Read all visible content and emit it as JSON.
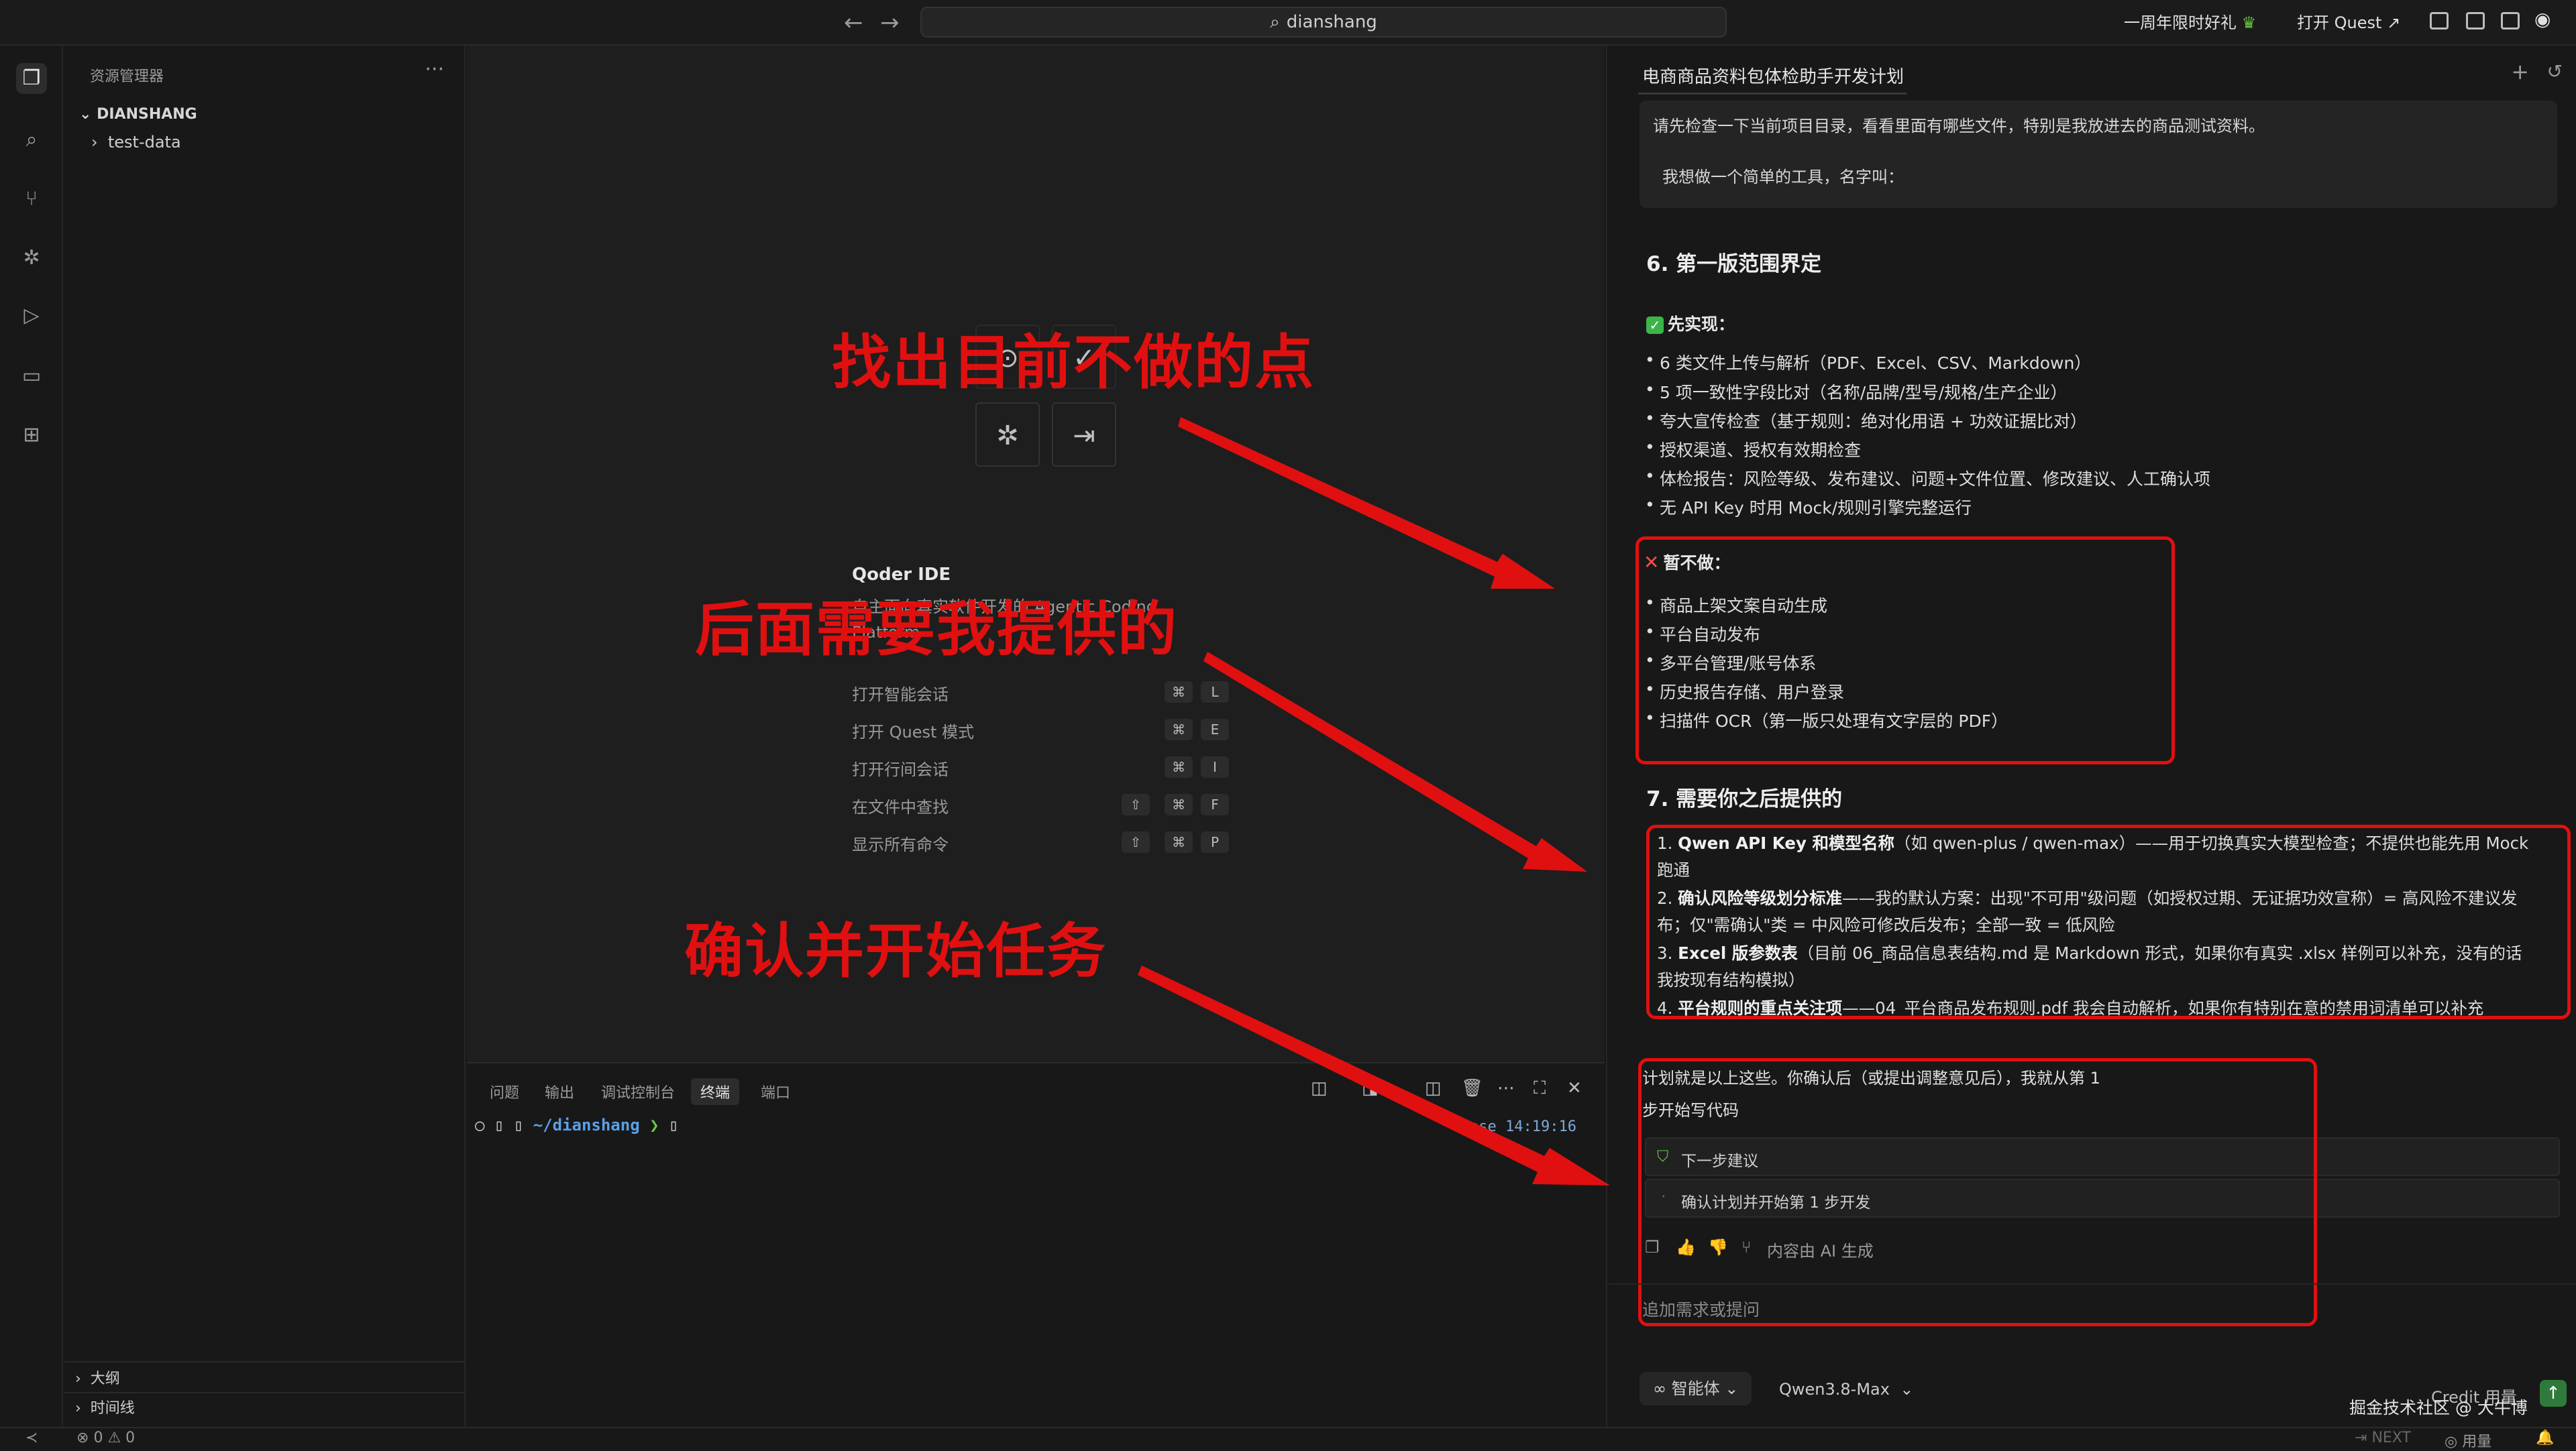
{
  "topbar": {
    "search_text": "dianshang",
    "anniversary_label": "一周年限时好礼",
    "quest_label": "打开 Quest"
  },
  "explorer": {
    "title": "资源管理器",
    "more": "···",
    "root": "DIANSHANG",
    "items": [
      "test-data"
    ],
    "outline": "大纲",
    "timeline": "时间线"
  },
  "editor": {
    "qoder_title": "Qoder IDE",
    "qoder_subtitle": "自主面向真实软件开发的 Agentic Coding Platform",
    "shortcuts": [
      {
        "label": "打开智能会话",
        "keys": [
          "⌘",
          "L"
        ]
      },
      {
        "label": "打开 Quest 模式",
        "keys": [
          "⌘",
          "E"
        ]
      },
      {
        "label": "打开行间会话",
        "keys": [
          "⌘",
          "I"
        ]
      },
      {
        "label": "在文件中查找",
        "keys": [
          "⇧",
          "⌘",
          "F"
        ]
      },
      {
        "label": "显示所有命令",
        "keys": [
          "⇧",
          "⌘",
          "P"
        ]
      }
    ]
  },
  "panel": {
    "tabs": [
      "问题",
      "输出",
      "调试控制台",
      "终端",
      "端口"
    ],
    "active_tab": "终端",
    "prompt_path": "~/dianshang",
    "prompt_arrow": "❯",
    "time_text": "base  14:19:16"
  },
  "chat": {
    "title": "电商商品资料包体检助手开发计划",
    "user_line1": "请先检查一下当前项目目录，看看里面有哪些文件，特别是我放进去的商品测试资料。",
    "user_line2": "我想做一个简单的工具，名字叫：",
    "section6_title": "6. 第一版范围界定",
    "first_label": "先实现：",
    "first_items": [
      "6 类文件上传与解析（PDF、Excel、CSV、Markdown）",
      "5 项一致性字段比对（名称/品牌/型号/规格/生产企业）",
      "夸大宣传检查（基于规则：绝对化用语 + 功效证据比对）",
      "授权渠道、授权有效期检查",
      "体检报告：风险等级、发布建议、问题+文件位置、修改建议、人工确认项",
      "无 API Key 时用 Mock/规则引擎完整运行"
    ],
    "notnow_label": "暂不做：",
    "notnow_items": [
      "商品上架文案自动生成",
      "平台自动发布",
      "多平台管理/账号体系",
      "历史报告存储、用户登录",
      "扫描件 OCR（第一版只处理有文字层的 PDF）"
    ],
    "section7_title": "7. 需要你之后提供的",
    "provide_items": [
      {
        "bold": "Qwen API Key 和模型名称",
        "rest": "（如 qwen-plus / qwen-max）——用于切换真实大模型检查；不提供也能先用 Mock 跑通"
      },
      {
        "bold": "确认风险等级划分标准",
        "rest": "——我的默认方案：出现\"不可用\"级问题（如授权过期、无证据功效宣称）= 高风险不建议发布；仅\"需确认\"类 = 中风险可修改后发布；全部一致 = 低风险"
      },
      {
        "bold": "Excel 版参数表",
        "rest": "（目前 06_商品信息表结构.md 是 Markdown 形式，如果你有真实 .xlsx 样例可以补充，没有的话我按现有结构模拟）"
      },
      {
        "bold": "平台规则的重点关注项",
        "rest": "——04_平台商品发布规则.pdf 我会自动解析，如果你有特别在意的禁用词清单可以补充"
      }
    ],
    "plan_line1": "计划就是以上这些。你确认后（或提出调整意见后），我就从第 1",
    "plan_line2": "步开始写代码",
    "next_suggest": "下一步建议",
    "confirm_start": "确认计划并开始第 1 步开发",
    "ai_generated": "内容由 AI 生成",
    "input_placeholder": "追加需求或提问",
    "agent_label": "智能体",
    "model_label": "Qwen3.8-Max",
    "credit_label": "Credit 用量",
    "watermark": "掘金技术社区 @ 大牛博"
  },
  "statusbar": {
    "errors": "0",
    "warnings": "0",
    "next": "NEXT",
    "usage": "用量"
  },
  "annotations": {
    "a1": "找出目前不做的点",
    "a2": "后面需要我提供的",
    "a3": "确认并开始任务"
  },
  "colors": {
    "annotation_red": "#e01010",
    "terminal_path": "#5aa0e6",
    "check_green": "#3bb54a"
  }
}
